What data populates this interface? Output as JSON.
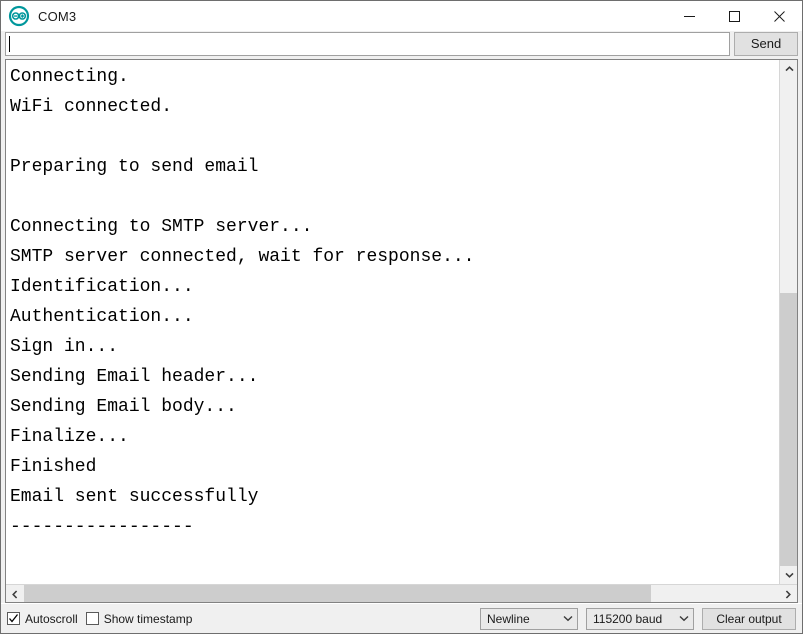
{
  "window": {
    "title": "COM3",
    "icon": "arduino-logo-icon",
    "accent": "#00979c",
    "controls": {
      "minimize": "minimize-icon",
      "maximize": "maximize-icon",
      "close": "close-icon"
    }
  },
  "send_row": {
    "input_value": "",
    "input_placeholder": "",
    "send_label": "Send"
  },
  "console": {
    "lines": [
      "Connecting.",
      "WiFi connected.",
      "",
      "Preparing to send email",
      "",
      "Connecting to SMTP server...",
      "SMTP server connected, wait for response...",
      "Identification...",
      "Authentication...",
      "Sign in...",
      "Sending Email header...",
      "Sending Email body...",
      "Finalize...",
      "Finished",
      "Email sent successfully",
      "-----------------"
    ]
  },
  "scrollbars": {
    "vertical": {
      "up_icon": "chevron-up-icon",
      "down_icon": "chevron-down-icon",
      "thumb_top_pct": 44,
      "thumb_height_pct": 56
    },
    "horizontal": {
      "left_icon": "chevron-left-icon",
      "right_icon": "chevron-right-icon",
      "thumb_left_pct": 0,
      "thumb_width_pct": 83
    }
  },
  "status_bar": {
    "autoscroll": {
      "label": "Autoscroll",
      "checked": true
    },
    "show_timestamp": {
      "label": "Show timestamp",
      "checked": false
    },
    "line_ending": {
      "value": "Newline"
    },
    "baud_rate": {
      "value": "115200 baud"
    },
    "clear_output": {
      "label": "Clear output"
    }
  }
}
